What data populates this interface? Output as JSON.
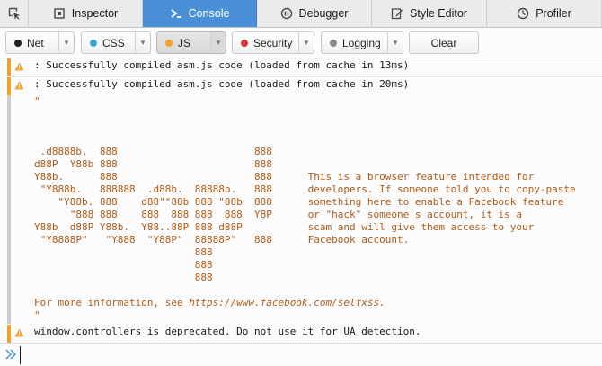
{
  "tabs": [
    {
      "label": "Inspector",
      "icon": "inspector-icon",
      "active": false
    },
    {
      "label": "Console",
      "icon": "console-icon",
      "active": true
    },
    {
      "label": "Debugger",
      "icon": "debugger-icon",
      "active": false
    },
    {
      "label": "Style Editor",
      "icon": "style-editor-icon",
      "active": false
    },
    {
      "label": "Profiler",
      "icon": "profiler-icon",
      "active": false
    }
  ],
  "filters": [
    {
      "label": "Net",
      "dot_color": "#222222",
      "active": false
    },
    {
      "label": "CSS",
      "dot_color": "#3aa8db",
      "active": false
    },
    {
      "label": "JS",
      "dot_color": "#f0a22e",
      "active": true
    },
    {
      "label": "Security",
      "dot_color": "#e0332f",
      "active": false
    },
    {
      "label": "Logging",
      "dot_color": "#8a8a8a",
      "active": false
    }
  ],
  "clear_label": "Clear",
  "messages": [
    {
      "level": "warning",
      "text": ": Successfully compiled asm.js code (loaded from cache in 13ms)"
    },
    {
      "level": "warning",
      "text": ": Successfully compiled asm.js code (loaded from cache in 20ms)"
    },
    {
      "level": "log",
      "open_quote": "\"",
      "art": "\n\n\n\n .d8888b.  888                       888\nd88P  Y88b 888                       888\nY88b.      888                       888      This is a browser feature intended for\n \"Y888b.   888888  .d88b.  88888b.   888      developers. If someone told you to copy-paste\n    \"Y88b. 888    d88\"\"88b 888 \"88b  888      something here to enable a Facebook feature\n      \"888 888    888  888 888  888  Y8P      or \"hack\" someone's account, it is a\nY88b  d88P Y88b.  Y88..88P 888 d88P           scam and will give them access to your\n \"Y8888P\"   \"Y888  \"Y88P\"  88888P\"   888      Facebook account.\n                           888\n                           888\n                           888\n",
      "more_prefix": "For more information, see ",
      "link": "https://www.facebook.com/selfxss.",
      "close_quote": "\""
    },
    {
      "level": "warning",
      "text": "window.controllers is deprecated. Do not use it for UA detection."
    }
  ],
  "input": {
    "value": ""
  },
  "colors": {
    "active_tab": "#4a90d9",
    "warning": "#f0a22e",
    "log_text": "#b05a17"
  }
}
